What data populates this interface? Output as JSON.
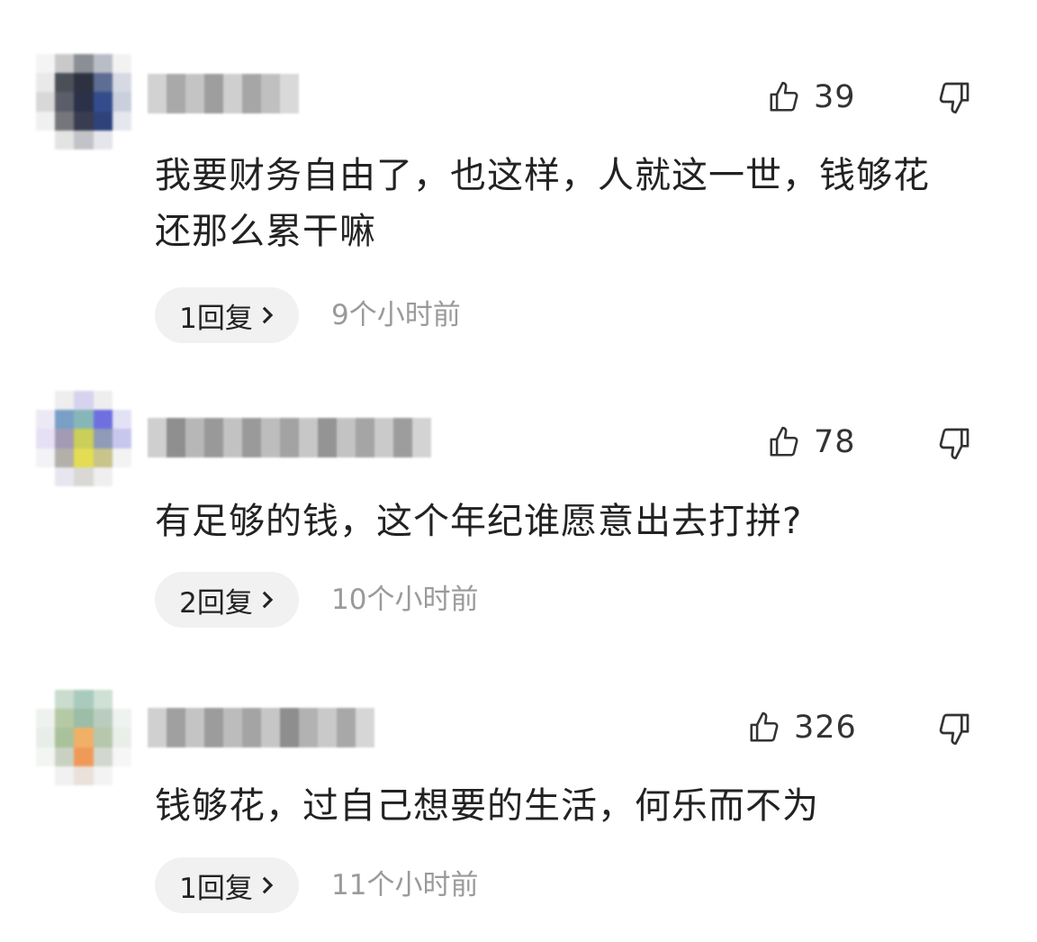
{
  "colors": {
    "text": "#222222",
    "secondary": "#9a9a9a",
    "reply_bg": "#f1f1f1"
  },
  "comments": [
    {
      "likes": "39",
      "text_lines": [
        "我要财务自由了，也这样，人就这一世，钱够花",
        "还那么累干嘛"
      ],
      "reply_label": "1回复",
      "time": "9个小时前"
    },
    {
      "likes": "78",
      "text_lines": [
        "有足够的钱，这个年纪谁愿意出去打拼?"
      ],
      "reply_label": "2回复",
      "time": "10个小时前"
    },
    {
      "likes": "326",
      "text_lines": [
        "钱够花，过自己想要的生活，何乐而不为"
      ],
      "reply_label": "1回复",
      "time": "11个小时前"
    }
  ],
  "icons": {
    "like": "thumbs-up-icon",
    "dislike": "thumbs-down-icon",
    "reply_arrow": "chevron-right-icon"
  }
}
